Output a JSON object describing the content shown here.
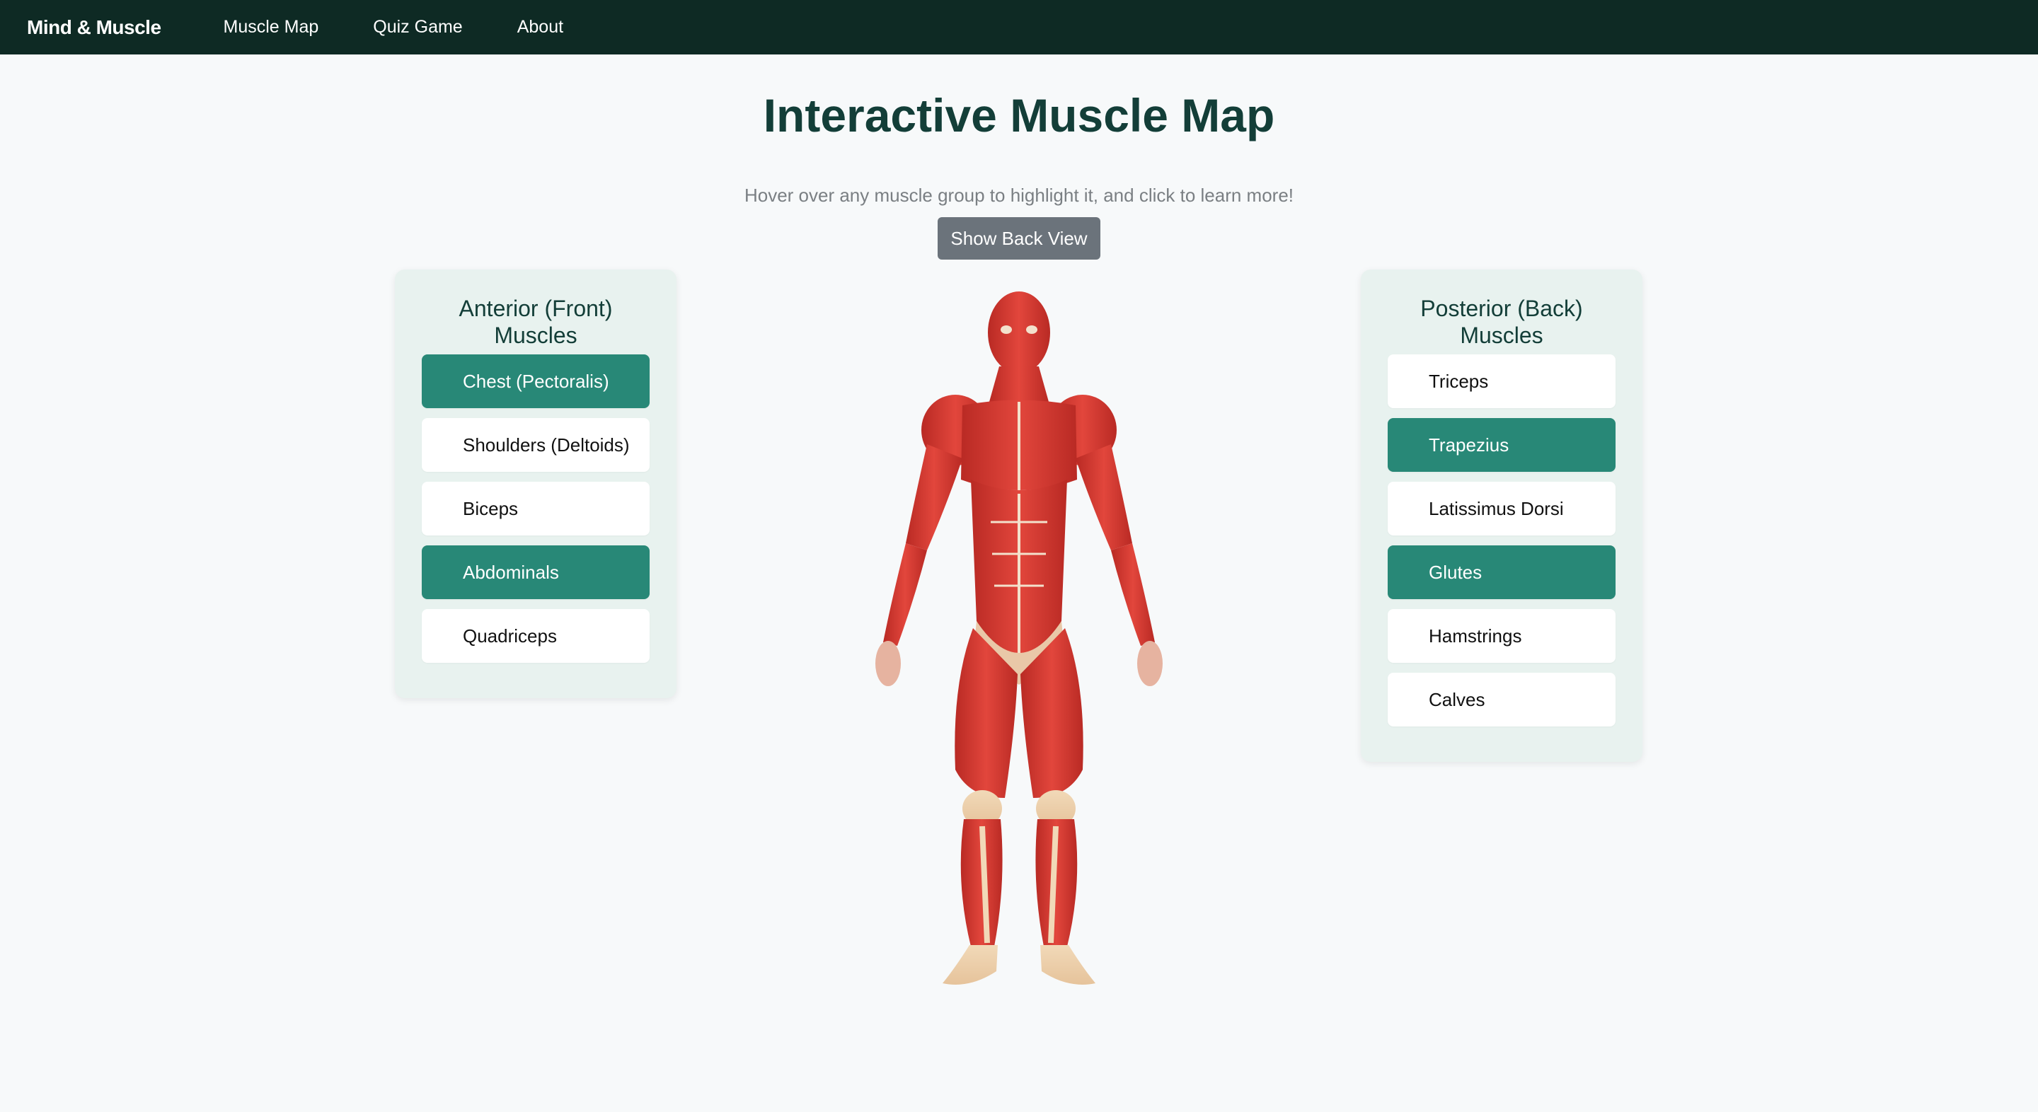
{
  "nav": {
    "brand": "Mind & Muscle",
    "links": [
      "Muscle Map",
      "Quiz Game",
      "About"
    ]
  },
  "main": {
    "title": "Interactive Muscle Map",
    "subtitle": "Hover over any muscle group to highlight it, and click to learn more!",
    "toggle_button": "Show Back View"
  },
  "anterior": {
    "title": "Anterior (Front) Muscles",
    "items": [
      {
        "label": "Chest (Pectoralis)",
        "active": true
      },
      {
        "label": "Shoulders (Deltoids)",
        "active": false
      },
      {
        "label": "Biceps",
        "active": false
      },
      {
        "label": "Abdominals",
        "active": true
      },
      {
        "label": "Quadriceps",
        "active": false
      }
    ]
  },
  "posterior": {
    "title": "Posterior (Back) Muscles",
    "items": [
      {
        "label": "Triceps",
        "active": false
      },
      {
        "label": "Trapezius",
        "active": true
      },
      {
        "label": "Latissimus Dorsi",
        "active": false
      },
      {
        "label": "Glutes",
        "active": true
      },
      {
        "label": "Hamstrings",
        "active": false
      },
      {
        "label": "Calves",
        "active": false
      }
    ]
  },
  "colors": {
    "navbar": "#0e2a24",
    "accent": "#288877",
    "title": "#133e38",
    "panel": "#e8f2ef",
    "muscle": "#d93a32"
  }
}
